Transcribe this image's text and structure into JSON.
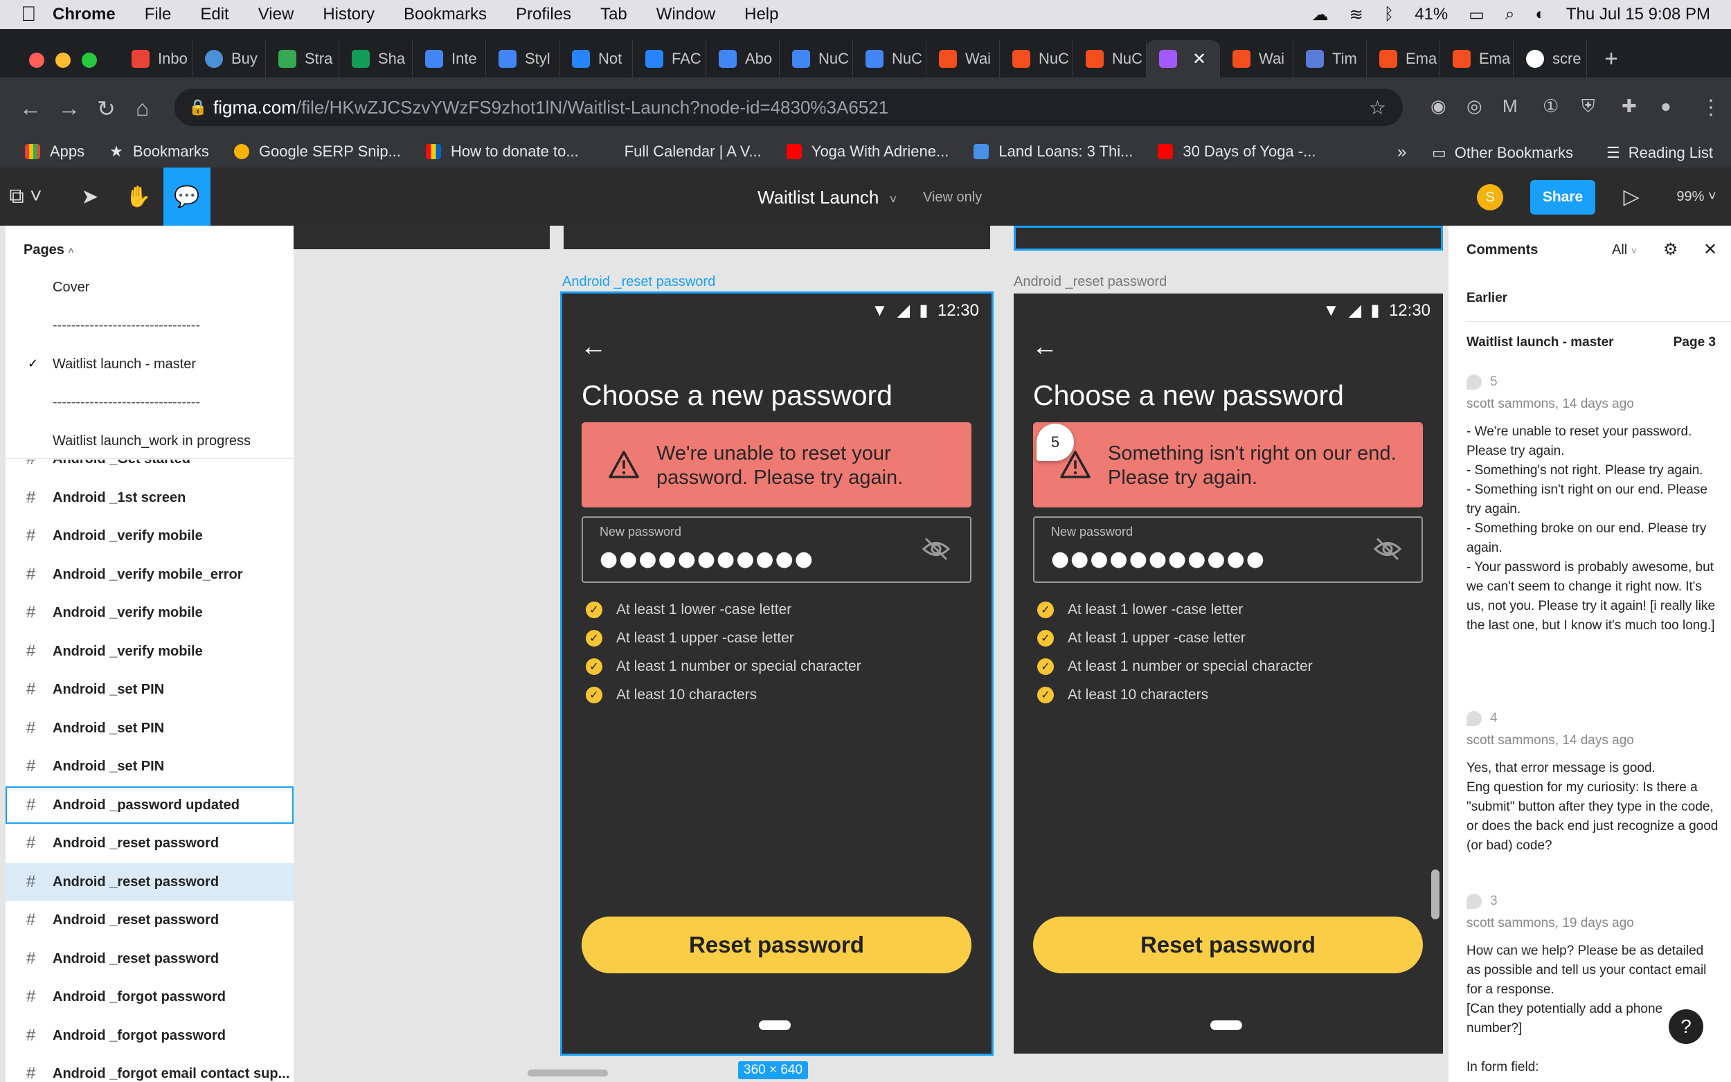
{
  "mac_menu": {
    "app": "Chrome",
    "items": [
      "File",
      "Edit",
      "View",
      "History",
      "Bookmarks",
      "Profiles",
      "Tab",
      "Window",
      "Help"
    ],
    "battery": "41%",
    "clock": "Thu Jul 15  9:08 PM"
  },
  "tabs": [
    "Inbo",
    "Buy",
    "Stra",
    "Sha",
    "Inte",
    "Styl",
    "Not",
    "FAC",
    "Abo",
    "NuC",
    "NuC",
    "Wai",
    "NuC",
    "NuC",
    "",
    "Wai",
    "Tim",
    "Ema",
    "Ema",
    "scre"
  ],
  "address": {
    "host": "figma.com",
    "path": "/file/HKwZJCSzvYWzFS9zhot1lN/Waitlist-Launch?node-id=4830%3A6521"
  },
  "bookmarks": [
    "Apps",
    "Bookmarks",
    "Google SERP Snip...",
    "How to donate to...",
    "Full Calendar | A V...",
    "Yoga With Adriene...",
    "Land Loans: 3 Thi...",
    "30 Days of Yoga -..."
  ],
  "bookmarks_more": "»",
  "other_bookmarks": "Other Bookmarks",
  "reading_list": "Reading List",
  "figma": {
    "file_title": "Waitlist Launch",
    "view_only": "View only",
    "user_initial": "S",
    "share": "Share",
    "zoom": "99%"
  },
  "pages": {
    "header": "Pages",
    "items": [
      "Cover",
      "--------------------------------",
      "Waitlist launch  - master",
      "--------------------------------",
      "Waitlist launch_work in progress"
    ]
  },
  "layers": [
    "Android _Get started",
    "Android _1st screen",
    "Android _verify mobile",
    "Android _verify mobile_error",
    "Android _verify mobile",
    "Android _verify mobile",
    "Android _set PIN",
    "Android _set PIN",
    "Android _set PIN",
    "Android _password updated",
    "Android _reset password",
    "Android _reset password",
    "Android _reset password",
    "Android _reset password",
    "Android _forgot password",
    "Android _forgot password",
    "Android _forgot email contact sup..."
  ],
  "frames": [
    {
      "label": "Android _reset password",
      "time": "12:30",
      "heading": "Choose a new password",
      "error": "We're unable to reset your password. Please try again.",
      "field_label": "New password",
      "field_value": "●●●●●●●●●●●",
      "rules": [
        "At least 1 lower -case letter",
        "At least 1 upper -case letter",
        "At least 1 number or special character",
        "At least 10 characters"
      ],
      "button": "Reset password"
    },
    {
      "label": "Android _reset password",
      "time": "12:30",
      "heading": "Choose a new password",
      "error": "Something isn't right on our end. Please try again.",
      "field_label": "New password",
      "field_value": "●●●●●●●●●●●",
      "rules": [
        "At least 1 lower -case letter",
        "At least 1 upper -case letter",
        "At least 1 number or special character",
        "At least 10 characters"
      ],
      "button": "Reset password"
    }
  ],
  "comment_pin": "5",
  "dimensions": "360 × 640",
  "comments_panel": {
    "title": "Comments",
    "filter": "All",
    "section": "Earlier",
    "thread_title": "Waitlist launch - master",
    "thread_page": "Page 3",
    "comments": [
      {
        "num": "5",
        "author": "scott sammons, 14 days ago",
        "body": "- We're unable to reset your password. Please try again.\n- Something's not right. Please try again.\n- Something isn't right on our end. Please try again.\n- Something broke on our end. Please try again.\n- Your password is probably awesome, but we can't seem to change it right now. It's us, not you. Please try it again! [i really like the last one, but I know it's much too long.]"
      },
      {
        "num": "4",
        "author": "scott sammons, 14 days ago",
        "body": "Yes, that error message is good.\nEng question for my curiosity: Is there a \"submit\" button after they type in the code, or does the back end just recognize a good (or bad) code?"
      },
      {
        "num": "3",
        "author": "scott sammons, 19 days ago",
        "body": "How can we help? Please be as detailed as possible and tell us your contact email for a response.\n[Can they potentially add a phone number?]\n\nIn form field:"
      }
    ]
  },
  "help": "?",
  "colors": {
    "figma_blue": "#18a0fb",
    "error_bg": "#ef7a73",
    "primary_yellow": "#f9cd46",
    "frame_bg": "#2e2e2e"
  }
}
